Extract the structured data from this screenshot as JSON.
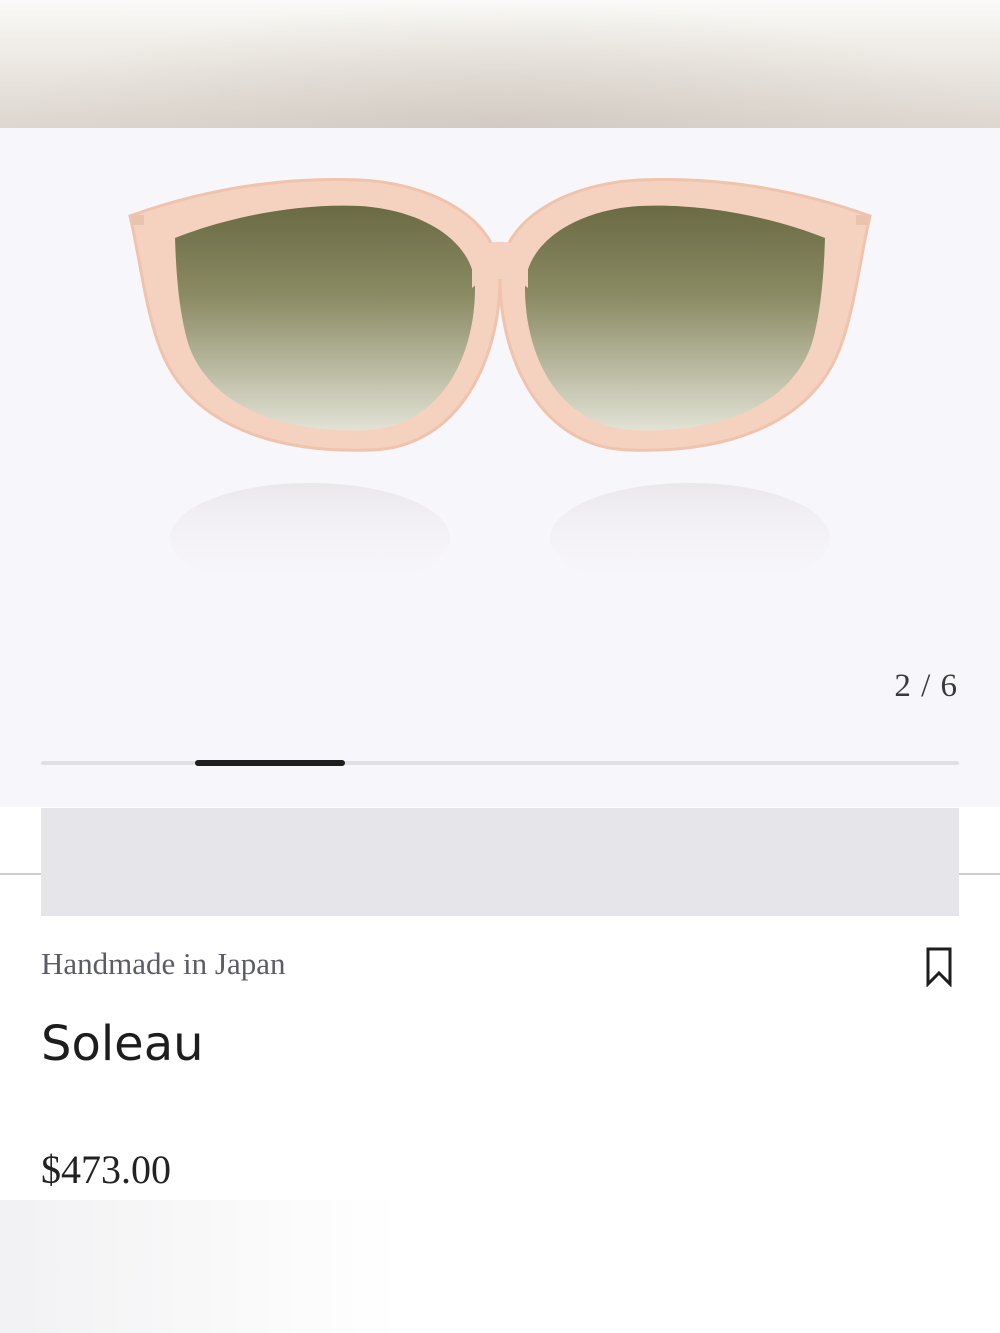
{
  "gallery": {
    "current": "2",
    "separator": "/",
    "total": "6",
    "progress": 0.33,
    "image_alt": "sunglasses-front-view"
  },
  "product": {
    "subtitle": "Handmade in Japan",
    "name": "Soleau",
    "price": "$473.00"
  },
  "icons": {
    "save": "bookmark-icon"
  },
  "colors": {
    "frame": "#f2c9b4",
    "lens_top": "#6f7049",
    "lens_bottom": "#dcdcd0",
    "gallery_bg": "#f7f6fa",
    "text_dark": "#1d1d1d",
    "text_muted": "#5c5c66"
  }
}
